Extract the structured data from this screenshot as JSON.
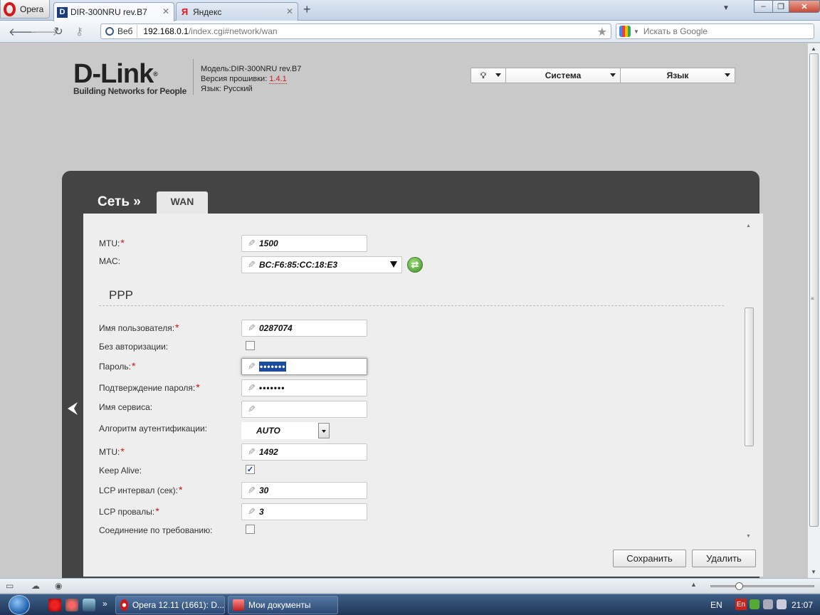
{
  "browser": {
    "menu_label": "Opera",
    "tabs": [
      {
        "label": "DIR-300NRU rev.B7",
        "favicon": "dlink-icon"
      },
      {
        "label": "Яндекс",
        "favicon": "yandex-icon"
      }
    ],
    "address": {
      "site_badge": "Веб",
      "url_host": "192.168.0.1",
      "url_path": "/index.cgi#network/wan"
    },
    "search": {
      "placeholder": "Искать в Google"
    }
  },
  "router": {
    "logo_brand": "D-Link",
    "logo_reg": "®",
    "logo_tagline": "Building Networks for People",
    "model_label": "Модель:",
    "model_value": "DIR-300NRU rev.B7",
    "firmware_label": "Версия прошивки:",
    "firmware_value": "1.4.1",
    "lang_label": "Язык:",
    "lang_value": "Русский",
    "top_menu": {
      "system_label": "Система",
      "language_label": "Язык"
    }
  },
  "page": {
    "breadcrumb": "Сеть »",
    "tab_label": "WAN",
    "ethernet": {
      "mtu_label": "MTU:",
      "mtu_value": "1500",
      "mac_label": "MAC:",
      "mac_value": "BC:F6:85:CC:18:E3"
    },
    "ppp": {
      "section_title": "PPP",
      "username_label": "Имя пользователя:",
      "username_value": "0287074",
      "no_auth_label": "Без авторизации:",
      "no_auth_checked": false,
      "password_label": "Пароль:",
      "password_value": "•••••••",
      "password_confirm_label": "Подтверждение пароля:",
      "password_confirm_value": "•••••••",
      "service_name_label": "Имя сервиса:",
      "service_name_value": "",
      "auth_algorithm_label": "Алгоритм аутентификации:",
      "auth_algorithm_value": "AUTO",
      "mtu_label": "MTU:",
      "mtu_value": "1492",
      "keep_alive_label": "Keep Alive:",
      "keep_alive_checked": true,
      "lcp_interval_label": "LCP интервал (сек):",
      "lcp_interval_value": "30",
      "lcp_fails_label": "LCP провалы:",
      "lcp_fails_value": "3",
      "on_demand_label": "Соединение по требованию:",
      "on_demand_checked": false
    },
    "required_mark": "*",
    "buttons": {
      "save": "Сохранить",
      "delete": "Удалить"
    }
  },
  "taskbar": {
    "tasks": [
      {
        "label": "Opera 12.11 (1661): D..."
      },
      {
        "label": "Мои документы"
      }
    ],
    "tray_lang": "EN",
    "tray_layout": "En",
    "clock": "21:07"
  },
  "colors": {
    "panel": "#444444",
    "content_bg": "#eeeeee",
    "required": "#dd1111",
    "firmware": "#c81e1e"
  }
}
